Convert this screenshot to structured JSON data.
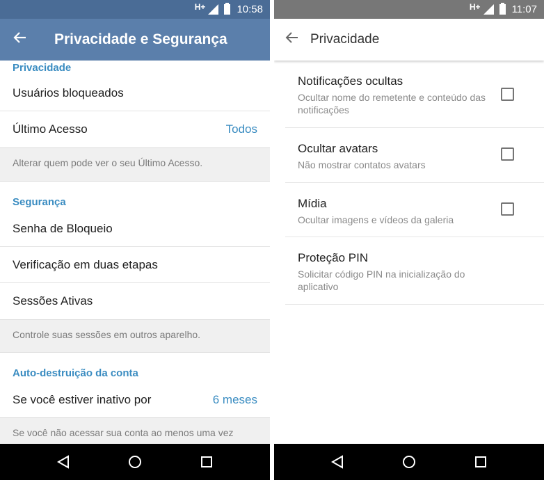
{
  "left": {
    "status": {
      "network": "H+",
      "time": "10:58"
    },
    "appbar": {
      "title": "Privacidade e Segurança"
    },
    "privacy": {
      "header": "Privacidade",
      "blocked_users": "Usuários bloqueados",
      "last_seen_label": "Último Acesso",
      "last_seen_value": "Todos",
      "info": "Alterar quem pode ver o seu Último Acesso."
    },
    "security": {
      "header": "Segurança",
      "passcode": "Senha de Bloqueio",
      "two_step": "Verificação em duas etapas",
      "sessions": "Sessões Ativas",
      "info": "Controle suas sessões em outros aparelho."
    },
    "self_destruct": {
      "header": "Auto-destruição da conta",
      "inactive_label": "Se você estiver inativo por",
      "inactive_value": "6 meses",
      "info": "Se você não acessar sua conta ao menos uma vez"
    }
  },
  "right": {
    "status": {
      "network": "H+",
      "time": "11:07"
    },
    "appbar": {
      "title": "Privacidade"
    },
    "items": [
      {
        "title": "Notificações ocultas",
        "subtitle": "Ocultar nome do remetente e conteúdo das notificações",
        "checked": false
      },
      {
        "title": "Ocultar avatars",
        "subtitle": "Não mostrar contatos avatars",
        "checked": false
      },
      {
        "title": "Mídia",
        "subtitle": "Ocultar imagens e vídeos da galeria",
        "checked": false
      },
      {
        "title": "Proteção PIN",
        "subtitle": "Solicitar código PIN na inicialização do aplicativo"
      }
    ]
  },
  "colors": {
    "accent": "#3a8cc1",
    "left_appbar": "#5b7fab",
    "left_statusbar": "#4a6c96",
    "right_statusbar": "#777777"
  },
  "icons": {
    "back": "arrow-back-icon",
    "nav_back": "triangle-back-icon",
    "nav_home": "circle-home-icon",
    "nav_recents": "square-recents-icon",
    "signal": "signal-icon",
    "battery": "battery-icon"
  }
}
